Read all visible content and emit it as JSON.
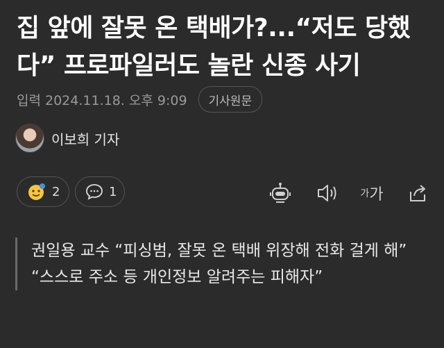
{
  "article": {
    "title": "집 앞에 잘못 온 택배가?...“저도 당했다” 프로파일러도 놀란 신종 사기",
    "published_label": "입력 2024.11.18. 오후 9:09",
    "original_button": "기사원문",
    "author": "이보희 기자"
  },
  "reactions": {
    "emoji_count": "2",
    "comment_count": "1"
  },
  "tools": {
    "font_small": "가",
    "font_big": "가",
    "robot_icon": "robot-icon",
    "audio_icon": "speaker-icon",
    "share_icon": "share-icon"
  },
  "subheadings": [
    "권일용 교수 “피싱범, 잘못 온 택배 위장해 전화 걸게 해”",
    "“스스로 주소 등 개인정보 알려주는 피해자”"
  ],
  "colors": {
    "background": "#2b2b2b",
    "title": "#ffffff",
    "meta": "#9a9a9a",
    "border": "#555555"
  }
}
